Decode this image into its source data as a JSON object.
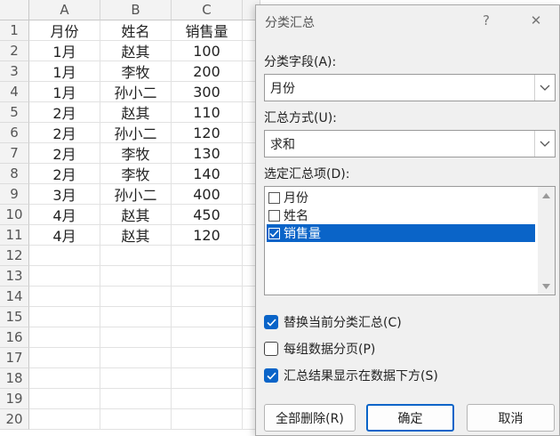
{
  "sheet": {
    "columns": [
      "A",
      "B",
      "C"
    ],
    "rows": [
      "1",
      "2",
      "3",
      "4",
      "5",
      "6",
      "7",
      "8",
      "9",
      "10",
      "11",
      "12",
      "13",
      "14",
      "15",
      "16",
      "17",
      "18",
      "19",
      "20"
    ],
    "data": [
      [
        "月份",
        "姓名",
        "销售量"
      ],
      [
        "1月",
        "赵其",
        "100"
      ],
      [
        "1月",
        "李牧",
        "200"
      ],
      [
        "1月",
        "孙小二",
        "300"
      ],
      [
        "2月",
        "赵其",
        "110"
      ],
      [
        "2月",
        "孙小二",
        "120"
      ],
      [
        "2月",
        "李牧",
        "130"
      ],
      [
        "2月",
        "李牧",
        "140"
      ],
      [
        "3月",
        "孙小二",
        "400"
      ],
      [
        "4月",
        "赵其",
        "450"
      ],
      [
        "4月",
        "赵其",
        "120"
      ]
    ]
  },
  "dialog": {
    "title": "分类汇总",
    "help": "?",
    "close": "✕",
    "group_by_label": "分类字段(A):",
    "group_by_value": "月份",
    "function_label": "汇总方式(U):",
    "function_value": "求和",
    "items_label": "选定汇总项(D):",
    "items": [
      {
        "label": "月份",
        "checked": false
      },
      {
        "label": "姓名",
        "checked": false
      },
      {
        "label": "销售量",
        "checked": true
      }
    ],
    "options": [
      {
        "label": "替换当前分类汇总(C)",
        "checked": true
      },
      {
        "label": "每组数据分页(P)",
        "checked": false
      },
      {
        "label": "汇总结果显示在数据下方(S)",
        "checked": true
      }
    ],
    "buttons": {
      "remove_all": "全部删除(R)",
      "ok": "确定",
      "cancel": "取消"
    },
    "accent_color": "#0a64c8"
  }
}
